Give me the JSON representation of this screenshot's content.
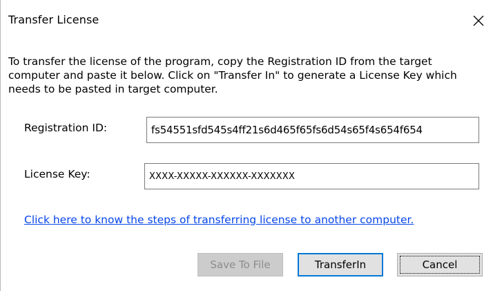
{
  "dialog": {
    "title": "Transfer License",
    "close_icon": "close-icon"
  },
  "description": "To transfer the license of the program, copy the Registration ID from the target computer and paste it below. Click on \"Transfer In\" to generate a License Key which needs to be pasted in target computer.",
  "registration": {
    "label": "Registration ID:",
    "value": "fs54551sfd545s4ff21s6d465f65fs6d54s65f4s654f654"
  },
  "license": {
    "label": "License Key:",
    "value": "XXXX-XXXXX-XXXXXX-XXXXXXX"
  },
  "help_link": "Click here to know the steps of transferring license to another computer.",
  "buttons": {
    "save_to_file": "Save To File",
    "transfer_in": "TransferIn",
    "cancel": "Cancel"
  },
  "colors": {
    "link": "#0645e8",
    "focus_border": "#0078d7",
    "disabled_text": "#8c8c8c"
  }
}
